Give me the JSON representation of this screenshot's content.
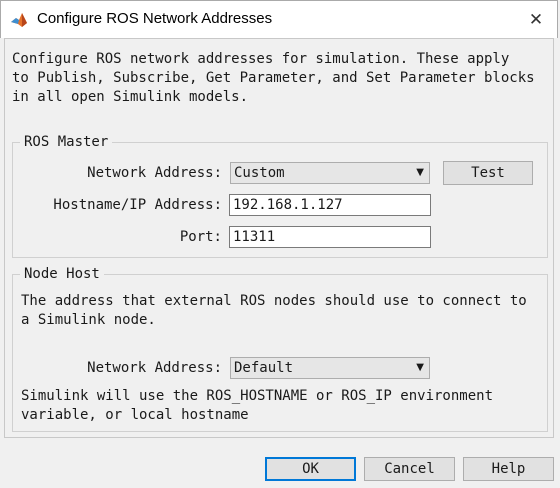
{
  "window": {
    "title": "Configure ROS Network Addresses",
    "close_symbol": "✕",
    "icon": "matlab-icon"
  },
  "intro_text": "Configure ROS network addresses for simulation. These apply\nto Publish, Subscribe, Get Parameter, and Set Parameter blocks\nin all open Simulink models.",
  "ros_master": {
    "title": "ROS Master",
    "network_address_label": "Network Address:",
    "network_address_value": "Custom",
    "test_button": "Test",
    "hostname_label": "Hostname/IP Address:",
    "hostname_value": "192.168.1.127",
    "port_label": "Port:",
    "port_value": "11311"
  },
  "node_host": {
    "title": "Node Host",
    "description": "The address that external ROS nodes should use to connect to\na Simulink node.",
    "network_address_label": "Network Address:",
    "network_address_value": "Default",
    "note": "Simulink will use the ROS_HOSTNAME or ROS_IP environment\nvariable, or local hostname"
  },
  "buttons": {
    "ok": "OK",
    "cancel": "Cancel",
    "help": "Help"
  },
  "colors": {
    "accent": "#0078d7",
    "window_bg": "#f0f0f0"
  }
}
